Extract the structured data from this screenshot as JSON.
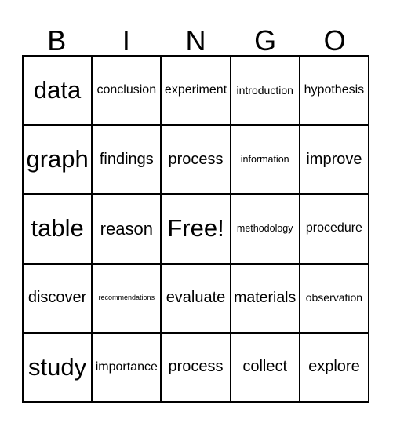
{
  "card": {
    "title": "BINGO",
    "header": {
      "letters": [
        "B",
        "I",
        "N",
        "G",
        "O"
      ]
    },
    "rows": [
      [
        {
          "text": "data",
          "size": "xl"
        },
        {
          "text": "conclusion",
          "size": "sm"
        },
        {
          "text": "experiment",
          "size": "sm"
        },
        {
          "text": "introduction",
          "size": "xs"
        },
        {
          "text": "hypothesis",
          "size": "sm"
        }
      ],
      [
        {
          "text": "graph",
          "size": "xl"
        },
        {
          "text": "findings",
          "size": "md"
        },
        {
          "text": "process",
          "size": "md"
        },
        {
          "text": "information",
          "size": "xxs"
        },
        {
          "text": "improve",
          "size": "md"
        }
      ],
      [
        {
          "text": "table",
          "size": "xl"
        },
        {
          "text": "reason",
          "size": "lg"
        },
        {
          "text": "Free!",
          "size": "xl"
        },
        {
          "text": "methodology",
          "size": "xxs"
        },
        {
          "text": "procedure",
          "size": "sm"
        }
      ],
      [
        {
          "text": "discover",
          "size": "md"
        },
        {
          "text": "recommendations",
          "size": "tiny"
        },
        {
          "text": "evaluate",
          "size": "md"
        },
        {
          "text": "materials",
          "size": "md"
        },
        {
          "text": "observation",
          "size": "xs"
        }
      ],
      [
        {
          "text": "study",
          "size": "xl"
        },
        {
          "text": "importance",
          "size": "sm"
        },
        {
          "text": "process",
          "size": "md"
        },
        {
          "text": "collect",
          "size": "md"
        },
        {
          "text": "explore",
          "size": "md"
        }
      ]
    ],
    "free_space": {
      "row": 2,
      "col": 2,
      "label": "Free!"
    },
    "colors": {
      "background": "#ffffff",
      "border": "#000000",
      "text": "#000000"
    }
  }
}
